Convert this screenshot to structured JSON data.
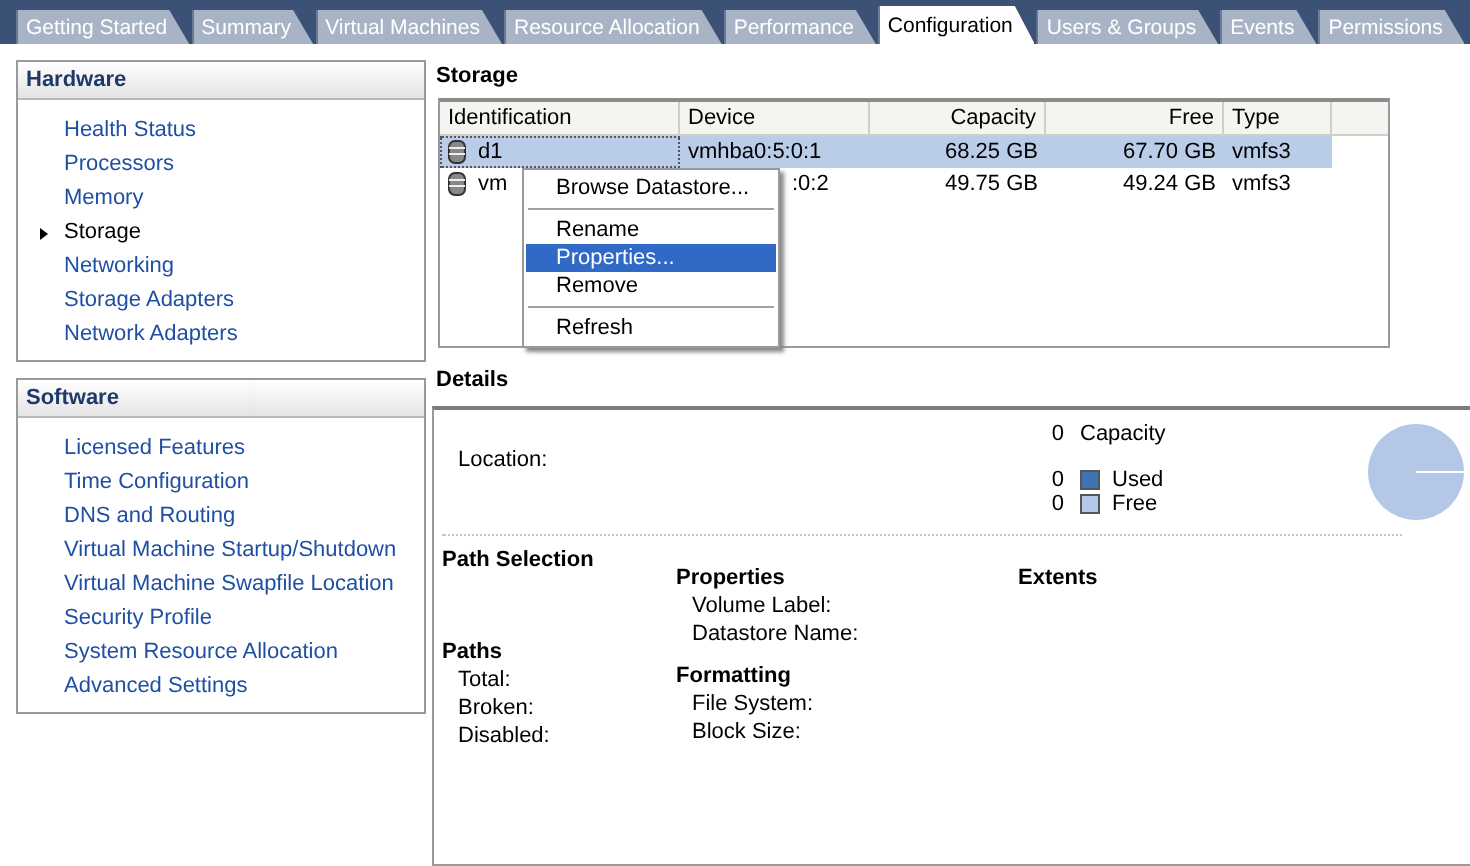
{
  "tabs": [
    {
      "label": "Getting Started",
      "selected": false
    },
    {
      "label": "Summary",
      "selected": false
    },
    {
      "label": "Virtual Machines",
      "selected": false
    },
    {
      "label": "Resource Allocation",
      "selected": false
    },
    {
      "label": "Performance",
      "selected": false
    },
    {
      "label": "Configuration",
      "selected": true
    },
    {
      "label": "Users & Groups",
      "selected": false
    },
    {
      "label": "Events",
      "selected": false
    },
    {
      "label": "Permissions",
      "selected": false
    }
  ],
  "sidebar": [
    {
      "title": "Hardware",
      "items": [
        {
          "label": "Health Status",
          "selected": false
        },
        {
          "label": "Processors",
          "selected": false
        },
        {
          "label": "Memory",
          "selected": false
        },
        {
          "label": "Storage",
          "selected": true
        },
        {
          "label": "Networking",
          "selected": false
        },
        {
          "label": "Storage Adapters",
          "selected": false
        },
        {
          "label": "Network Adapters",
          "selected": false
        }
      ]
    },
    {
      "title": "Software",
      "items": [
        {
          "label": "Licensed Features",
          "selected": false
        },
        {
          "label": "Time Configuration",
          "selected": false
        },
        {
          "label": "DNS and Routing",
          "selected": false
        },
        {
          "label": "Virtual Machine Startup/Shutdown",
          "selected": false
        },
        {
          "label": "Virtual Machine Swapfile Location",
          "selected": false
        },
        {
          "label": "Security Profile",
          "selected": false
        },
        {
          "label": "System Resource Allocation",
          "selected": false
        },
        {
          "label": "Advanced Settings",
          "selected": false
        }
      ]
    }
  ],
  "storage": {
    "title": "Storage",
    "columns": [
      "Identification",
      "Device",
      "Capacity",
      "Free",
      "Type"
    ],
    "rows": [
      {
        "selected": true,
        "cells": [
          "d1",
          "vmhba0:5:0:1",
          "68.25 GB",
          "67.70 GB",
          "vmfs3"
        ]
      },
      {
        "selected": false,
        "cells": [
          "vm",
          ":0:2",
          "49.75 GB",
          "49.24 GB",
          "vmfs3"
        ]
      }
    ]
  },
  "context_menu": {
    "items": [
      {
        "kind": "item",
        "label": "Browse Datastore...",
        "selected": false
      },
      {
        "kind": "separator"
      },
      {
        "kind": "item",
        "label": "Rename",
        "selected": false
      },
      {
        "kind": "item",
        "label": "Properties...",
        "selected": true
      },
      {
        "kind": "item",
        "label": "Remove",
        "selected": false
      },
      {
        "kind": "separator"
      },
      {
        "kind": "item",
        "label": "Refresh",
        "selected": false
      }
    ]
  },
  "details": {
    "title": "Details",
    "location_label": "Location:",
    "capacity": {
      "value": "0",
      "label": "Capacity"
    },
    "legend": [
      {
        "value": "0",
        "label": "Used",
        "color": "#3f74b3"
      },
      {
        "value": "0",
        "label": "Free",
        "color": "#b4c7e7"
      }
    ],
    "path_selection": "Path Selection",
    "paths": {
      "title": "Paths",
      "fields": [
        "Total:",
        "Broken:",
        "Disabled:"
      ]
    },
    "properties": {
      "title": "Properties",
      "fields": [
        "Volume Label:",
        "Datastore Name:"
      ]
    },
    "formatting": {
      "title": "Formatting",
      "fields": [
        "File System:",
        "Block Size:"
      ]
    },
    "extents": "Extents"
  }
}
